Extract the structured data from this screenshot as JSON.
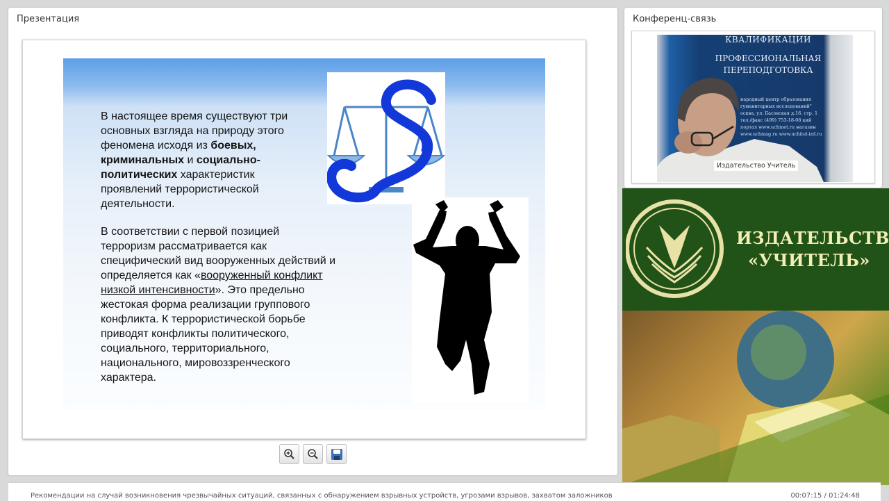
{
  "presentation": {
    "title": "Презентация",
    "slide": {
      "para1_a": "В настоящее время существуют три основных взгляда на природу этого феномена исходя из ",
      "para1_b1": "боевых, криминальных",
      "para1_c": " и ",
      "para1_b2": "социально-политических",
      "para1_d": " характеристик проявлений террористической деятельности.",
      "para2_a": "В соответствии с первой позицией терроризм рассматривается как специфический вид вооруженных действий и определяется как «",
      "para2_u": "вооруженный конфликт низкой интенсивности",
      "para2_b": "». Это предельно жестокая форма реализации группового конфликта. К террористической борьбе приводят конфликты политического, социального, территориального, национального, мировоззренческого характера."
    },
    "toolbar": [
      "zoom-in",
      "zoom-out",
      "save"
    ]
  },
  "conference": {
    "title": "Конференц-связь",
    "poster_line1": "КВАЛИФИКАЦИИ",
    "poster_line2": "ПРОФЕССИОНАЛЬНАЯ ПЕРЕПОДГОТОВКА",
    "poster_small": "народный центр образования гуманитарных исследований\" осква, ул. Басовская д.16, стр. 1 тел./факс (499) 753-18-08 кий портал www.uchmet.ru магазин www.uchmag.ru www.uchitel-izd.ru",
    "video_caption": "Издательство Учитель"
  },
  "banner": {
    "name_line1": "ИЗДАТЕЛЬСТВО",
    "name_line2": "«УЧИТЕЛЬ»"
  },
  "bottom": {
    "lecture_title": "Рекомендации на случай возникновения чрезвычайных ситуаций, связанных с обнаружением взрывных устройств, угрозами взрывов, захватом заложников",
    "time": "00:07:15 / 01:24:48"
  }
}
